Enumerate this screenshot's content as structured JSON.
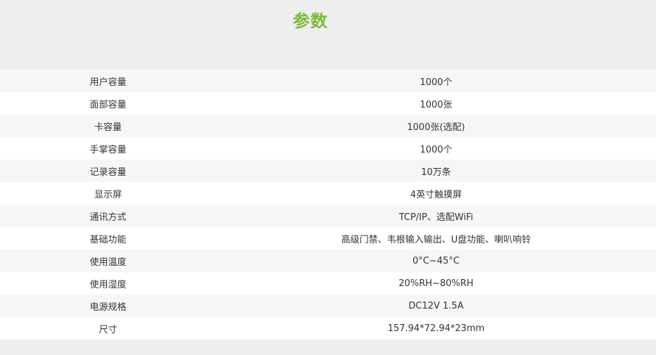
{
  "title": "参数",
  "specs": [
    {
      "label": "用户容量",
      "value": "1000个"
    },
    {
      "label": "面部容量",
      "value": "1000张"
    },
    {
      "label": "卡容量",
      "value": "1000张(选配)"
    },
    {
      "label": "手掌容量",
      "value": "1000个"
    },
    {
      "label": "记录容量",
      "value": "10万条"
    },
    {
      "label": "显示屏",
      "value": "4英寸触摸屏"
    },
    {
      "label": "通讯方式",
      "value": "TCP/IP、选配WiFi"
    },
    {
      "label": "基础功能",
      "value": "高级门禁、韦根输入输出、U盘功能、喇叭响铃"
    },
    {
      "label": "使用温度",
      "value": "0°C~45°C"
    },
    {
      "label": "使用湿度",
      "value": "20%RH~80%RH"
    },
    {
      "label": "电源规格",
      "value": "DC12V 1.5A"
    },
    {
      "label": "尺寸",
      "value": "157.94*72.94*23mm"
    }
  ],
  "colors": {
    "accent": "#7dbb37",
    "background": "#eeeeee",
    "row_odd": "#f6f6f6",
    "row_even": "#ffffff",
    "text": "#333333"
  }
}
